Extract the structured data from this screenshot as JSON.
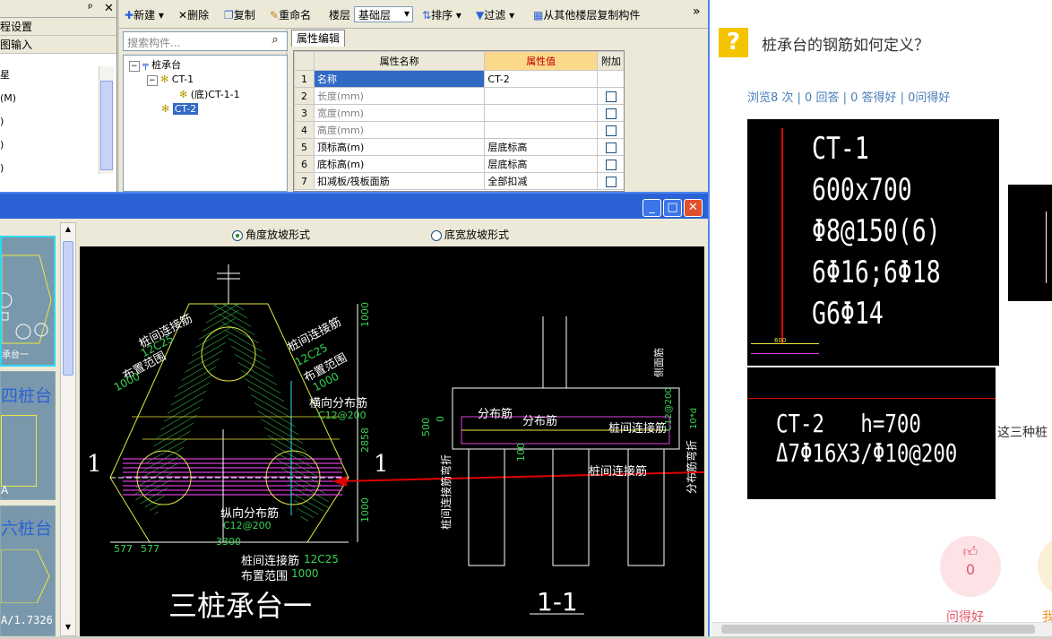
{
  "left_dock": {
    "pin": "ᵖ",
    "close": "✕",
    "rows": [
      "程设置",
      "图输入"
    ],
    "items": [
      "星",
      "(M)",
      ")",
      ")",
      ")"
    ]
  },
  "toolbar": {
    "new": "新建",
    "delete": "删除",
    "copy": "复制",
    "rename": "重命名",
    "floor_label": "楼层",
    "floor_value": "基础层",
    "sort": "排序",
    "filter": "过滤",
    "copy_from_floor": "从其他楼层复制构件",
    "more": "»"
  },
  "tree": {
    "search_placeholder": "搜索构件...",
    "root": "桩承台",
    "ct1": "CT-1",
    "ct1_child": "(底)CT-1-1",
    "ct2": "CT-2"
  },
  "attributes": {
    "tab": "属性编辑",
    "headers": [
      "属性名称",
      "属性值",
      "附加"
    ],
    "rows": [
      {
        "n": "1",
        "name": "名称",
        "value": "CT-2",
        "check": false
      },
      {
        "n": "2",
        "name": "长度(mm)",
        "value": "",
        "check": true
      },
      {
        "n": "3",
        "name": "宽度(mm)",
        "value": "",
        "check": true
      },
      {
        "n": "4",
        "name": "高度(mm)",
        "value": "",
        "check": true
      },
      {
        "n": "5",
        "name": "顶标高(m)",
        "value": "层底标高",
        "check": true
      },
      {
        "n": "6",
        "name": "底标高(m)",
        "value": "层底标高",
        "check": true
      },
      {
        "n": "7",
        "name": "扣减板/筏板面筋",
        "value": "全部扣减",
        "check": true
      }
    ]
  },
  "dialog": {
    "min": "_",
    "max": "□",
    "close": "✕",
    "radio1": "角度放坡形式",
    "radio2": "底宽放坡形式",
    "thumbs": [
      "承台一",
      "四桩台",
      "A",
      "六桩台",
      "A/1.7326"
    ]
  },
  "cad": {
    "labels": {
      "pile_conn1": "桩间连接筋",
      "c12c25a": "12C25",
      "range1": "布置范围",
      "n1000a": "1000",
      "pile_conn2": "桩间连接筋",
      "c12c25b": "12C25",
      "range2": "布置范围",
      "n1000b": "1000",
      "horiz": "横向分布筋",
      "c12at200": "C12@200",
      "long": "纵向分布筋",
      "c12at200b": "C12@200",
      "pile_conn3": "桩间连接筋",
      "c12c25c": "12C25",
      "range3": "布置范围",
      "n1000c": "1000",
      "d1000": "1000",
      "d2858": "2858",
      "d1000b": "1000",
      "d577a": "577",
      "d577b": "577",
      "d3300": "3300",
      "one_left": "1",
      "one_right": "1",
      "title": "三桩承台一",
      "s_dist1": "分布筋",
      "s_dist2": "分布筋",
      "s_conn": "桩间连接筋",
      "s_side": "侧面筋",
      "s_c12": "C12@200",
      "s_10d": "10*d",
      "s_bend": "分布筋弯折",
      "s_conn2": "桩间连接筋",
      "s_conn_bend": "桩间连接筋弯折",
      "s_500": "500",
      "s_0": "0",
      "s_100": "100",
      "section": "1-1"
    }
  },
  "qa": {
    "icon": "?",
    "title": "桩承台的钢筋如何定义？",
    "stats": "浏览8 次 | 0 回答 | 0 答得好 | 0问得好",
    "img1": {
      "l1": "CT-1",
      "l2": "600x700",
      "l3": "Φ8@150(6)",
      "l4": "6Φ16;6Φ18",
      "l5": "G6Φ14",
      "dim": "600"
    },
    "img3": {
      "l1": "CT-2",
      "l1b": "h=700",
      "l2": "Δ7Φ16X3/Φ10@200"
    },
    "cut_text": "这三种桩",
    "like_count": "0",
    "like_label": "问得好",
    "like2_label": "我"
  },
  "colors": {
    "cad_green": "#39d353",
    "cad_magenta": "#e040e0",
    "cad_yellow": "#e8e840",
    "cad_red": "#e00000",
    "title_blue": "#2b63d6"
  }
}
